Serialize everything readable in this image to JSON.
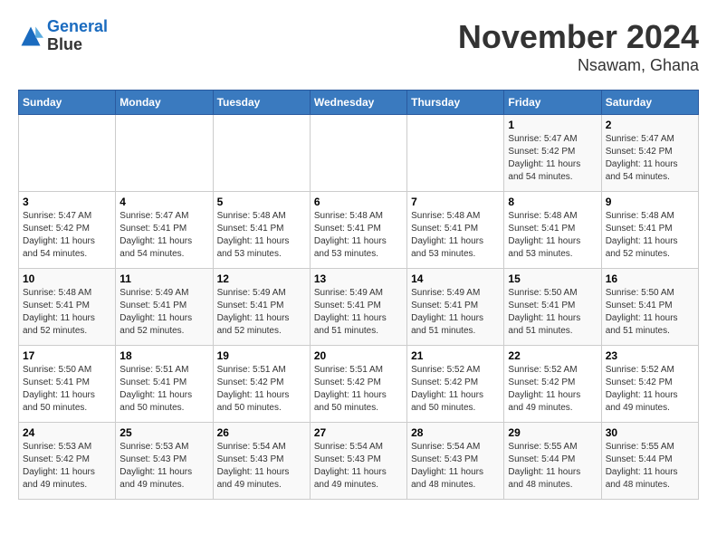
{
  "logo": {
    "line1": "General",
    "line2": "Blue"
  },
  "title": "November 2024",
  "subtitle": "Nsawam, Ghana",
  "weekdays": [
    "Sunday",
    "Monday",
    "Tuesday",
    "Wednesday",
    "Thursday",
    "Friday",
    "Saturday"
  ],
  "weeks": [
    [
      {
        "day": "",
        "info": ""
      },
      {
        "day": "",
        "info": ""
      },
      {
        "day": "",
        "info": ""
      },
      {
        "day": "",
        "info": ""
      },
      {
        "day": "",
        "info": ""
      },
      {
        "day": "1",
        "info": "Sunrise: 5:47 AM\nSunset: 5:42 PM\nDaylight: 11 hours\nand 54 minutes."
      },
      {
        "day": "2",
        "info": "Sunrise: 5:47 AM\nSunset: 5:42 PM\nDaylight: 11 hours\nand 54 minutes."
      }
    ],
    [
      {
        "day": "3",
        "info": "Sunrise: 5:47 AM\nSunset: 5:42 PM\nDaylight: 11 hours\nand 54 minutes."
      },
      {
        "day": "4",
        "info": "Sunrise: 5:47 AM\nSunset: 5:41 PM\nDaylight: 11 hours\nand 54 minutes."
      },
      {
        "day": "5",
        "info": "Sunrise: 5:48 AM\nSunset: 5:41 PM\nDaylight: 11 hours\nand 53 minutes."
      },
      {
        "day": "6",
        "info": "Sunrise: 5:48 AM\nSunset: 5:41 PM\nDaylight: 11 hours\nand 53 minutes."
      },
      {
        "day": "7",
        "info": "Sunrise: 5:48 AM\nSunset: 5:41 PM\nDaylight: 11 hours\nand 53 minutes."
      },
      {
        "day": "8",
        "info": "Sunrise: 5:48 AM\nSunset: 5:41 PM\nDaylight: 11 hours\nand 53 minutes."
      },
      {
        "day": "9",
        "info": "Sunrise: 5:48 AM\nSunset: 5:41 PM\nDaylight: 11 hours\nand 52 minutes."
      }
    ],
    [
      {
        "day": "10",
        "info": "Sunrise: 5:48 AM\nSunset: 5:41 PM\nDaylight: 11 hours\nand 52 minutes."
      },
      {
        "day": "11",
        "info": "Sunrise: 5:49 AM\nSunset: 5:41 PM\nDaylight: 11 hours\nand 52 minutes."
      },
      {
        "day": "12",
        "info": "Sunrise: 5:49 AM\nSunset: 5:41 PM\nDaylight: 11 hours\nand 52 minutes."
      },
      {
        "day": "13",
        "info": "Sunrise: 5:49 AM\nSunset: 5:41 PM\nDaylight: 11 hours\nand 51 minutes."
      },
      {
        "day": "14",
        "info": "Sunrise: 5:49 AM\nSunset: 5:41 PM\nDaylight: 11 hours\nand 51 minutes."
      },
      {
        "day": "15",
        "info": "Sunrise: 5:50 AM\nSunset: 5:41 PM\nDaylight: 11 hours\nand 51 minutes."
      },
      {
        "day": "16",
        "info": "Sunrise: 5:50 AM\nSunset: 5:41 PM\nDaylight: 11 hours\nand 51 minutes."
      }
    ],
    [
      {
        "day": "17",
        "info": "Sunrise: 5:50 AM\nSunset: 5:41 PM\nDaylight: 11 hours\nand 50 minutes."
      },
      {
        "day": "18",
        "info": "Sunrise: 5:51 AM\nSunset: 5:41 PM\nDaylight: 11 hours\nand 50 minutes."
      },
      {
        "day": "19",
        "info": "Sunrise: 5:51 AM\nSunset: 5:42 PM\nDaylight: 11 hours\nand 50 minutes."
      },
      {
        "day": "20",
        "info": "Sunrise: 5:51 AM\nSunset: 5:42 PM\nDaylight: 11 hours\nand 50 minutes."
      },
      {
        "day": "21",
        "info": "Sunrise: 5:52 AM\nSunset: 5:42 PM\nDaylight: 11 hours\nand 50 minutes."
      },
      {
        "day": "22",
        "info": "Sunrise: 5:52 AM\nSunset: 5:42 PM\nDaylight: 11 hours\nand 49 minutes."
      },
      {
        "day": "23",
        "info": "Sunrise: 5:52 AM\nSunset: 5:42 PM\nDaylight: 11 hours\nand 49 minutes."
      }
    ],
    [
      {
        "day": "24",
        "info": "Sunrise: 5:53 AM\nSunset: 5:42 PM\nDaylight: 11 hours\nand 49 minutes."
      },
      {
        "day": "25",
        "info": "Sunrise: 5:53 AM\nSunset: 5:43 PM\nDaylight: 11 hours\nand 49 minutes."
      },
      {
        "day": "26",
        "info": "Sunrise: 5:54 AM\nSunset: 5:43 PM\nDaylight: 11 hours\nand 49 minutes."
      },
      {
        "day": "27",
        "info": "Sunrise: 5:54 AM\nSunset: 5:43 PM\nDaylight: 11 hours\nand 49 minutes."
      },
      {
        "day": "28",
        "info": "Sunrise: 5:54 AM\nSunset: 5:43 PM\nDaylight: 11 hours\nand 48 minutes."
      },
      {
        "day": "29",
        "info": "Sunrise: 5:55 AM\nSunset: 5:44 PM\nDaylight: 11 hours\nand 48 minutes."
      },
      {
        "day": "30",
        "info": "Sunrise: 5:55 AM\nSunset: 5:44 PM\nDaylight: 11 hours\nand 48 minutes."
      }
    ]
  ]
}
